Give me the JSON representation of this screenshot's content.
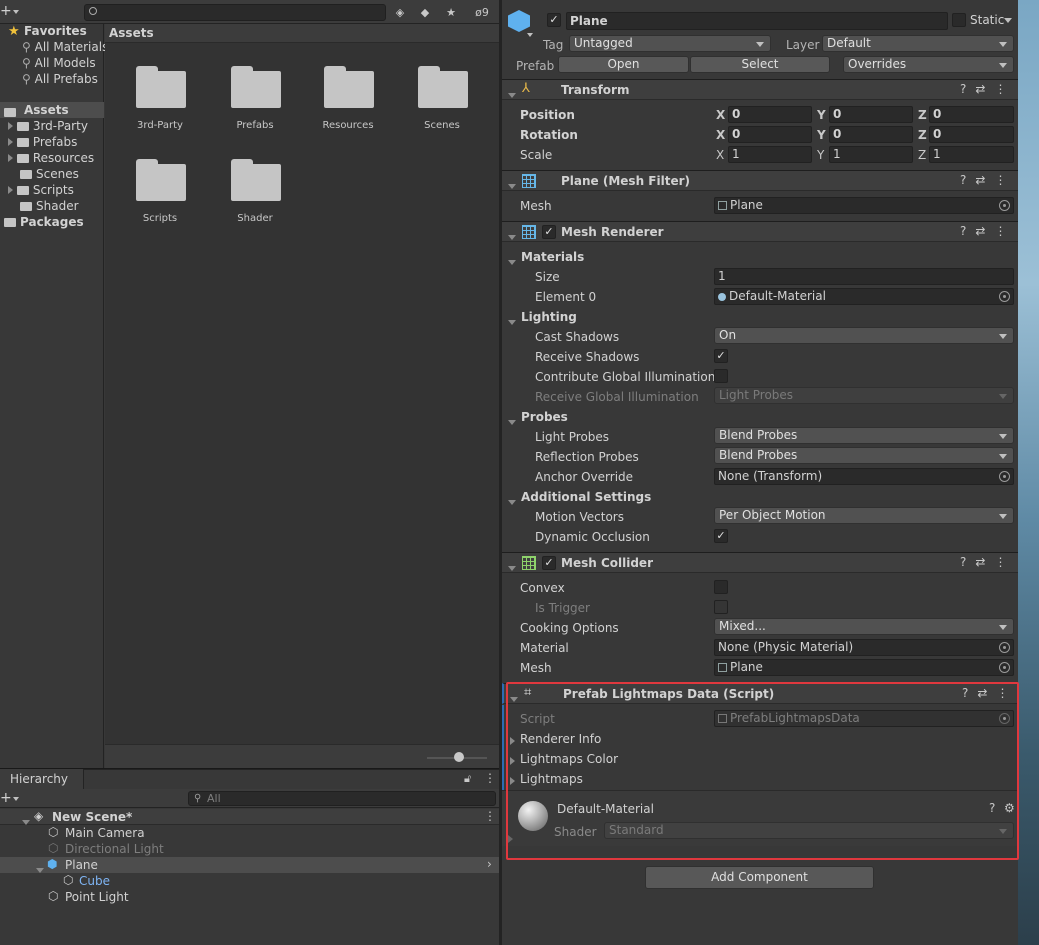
{
  "project": {
    "toolbar": {
      "add_label": "+",
      "hidden_count": "9"
    },
    "favorites": {
      "title": "Favorites",
      "items": [
        "All Materials",
        "All Models",
        "All Prefabs"
      ]
    },
    "tree": {
      "assets_label": "Assets",
      "folders": [
        "3rd-Party",
        "Prefabs",
        "Resources",
        "Scenes",
        "Scripts",
        "Shader"
      ],
      "packages_label": "Packages"
    },
    "grid": {
      "header": "Assets",
      "folders": [
        "3rd-Party",
        "Prefabs",
        "Resources",
        "Scenes",
        "Scripts",
        "Shader"
      ]
    }
  },
  "hierarchy": {
    "tab_label": "Hierarchy",
    "search_placeholder": "All",
    "scene": "New Scene*",
    "items": [
      {
        "label": "Main Camera",
        "state": "normal"
      },
      {
        "label": "Directional Light",
        "state": "disabled"
      },
      {
        "label": "Plane",
        "state": "selected"
      },
      {
        "label": "Cube",
        "state": "prefab-child"
      },
      {
        "label": "Point Light",
        "state": "normal"
      }
    ]
  },
  "inspector": {
    "object": {
      "name": "Plane",
      "static_label": "Static",
      "tag_label": "Tag",
      "tag_value": "Untagged",
      "layer_label": "Layer",
      "layer_value": "Default",
      "prefab_label": "Prefab",
      "open_label": "Open",
      "select_label": "Select",
      "overrides_label": "Overrides"
    },
    "transform": {
      "title": "Transform",
      "position_label": "Position",
      "rotation_label": "Rotation",
      "scale_label": "Scale",
      "axis_x": "X",
      "axis_y": "Y",
      "axis_z": "Z",
      "position": [
        "0",
        "0",
        "0"
      ],
      "rotation": [
        "0",
        "0",
        "0"
      ],
      "scale": [
        "1",
        "1",
        "1"
      ]
    },
    "mesh_filter": {
      "title": "Plane (Mesh Filter)",
      "mesh_label": "Mesh",
      "mesh_value": "Plane"
    },
    "mesh_renderer": {
      "title": "Mesh Renderer",
      "materials_label": "Materials",
      "size_label": "Size",
      "size_value": "1",
      "element0_label": "Element 0",
      "element0_value": "Default-Material",
      "lighting_label": "Lighting",
      "cast_shadows_label": "Cast Shadows",
      "cast_shadows_value": "On",
      "receive_shadows_label": "Receive Shadows",
      "contribute_gi_label": "Contribute Global Illumination",
      "receive_gi_label": "Receive Global Illumination",
      "receive_gi_value": "Light Probes",
      "probes_label": "Probes",
      "light_probes_label": "Light Probes",
      "light_probes_value": "Blend Probes",
      "reflection_probes_label": "Reflection Probes",
      "reflection_probes_value": "Blend Probes",
      "anchor_override_label": "Anchor Override",
      "anchor_override_value": "None (Transform)",
      "additional_label": "Additional Settings",
      "motion_vectors_label": "Motion Vectors",
      "motion_vectors_value": "Per Object Motion",
      "dynamic_occlusion_label": "Dynamic Occlusion"
    },
    "mesh_collider": {
      "title": "Mesh Collider",
      "convex_label": "Convex",
      "is_trigger_label": "Is Trigger",
      "cooking_label": "Cooking Options",
      "cooking_value": "Mixed...",
      "material_label": "Material",
      "material_value": "None (Physic Material)",
      "mesh_label": "Mesh",
      "mesh_value": "Plane"
    },
    "lightmaps_script": {
      "title": "Prefab Lightmaps Data (Script)",
      "script_label": "Script",
      "script_value": "PrefabLightmapsData",
      "renderer_info": "Renderer Info",
      "lightmaps_color": "Lightmaps Color",
      "lightmaps": "Lightmaps"
    },
    "material": {
      "name": "Default-Material",
      "shader_label": "Shader",
      "shader_value": "Standard"
    },
    "add_component_label": "Add Component"
  },
  "colors": {
    "highlight": "#e0383e",
    "selected_row": "#4d4d4d",
    "prefab_blue": "#7fb5f5"
  }
}
